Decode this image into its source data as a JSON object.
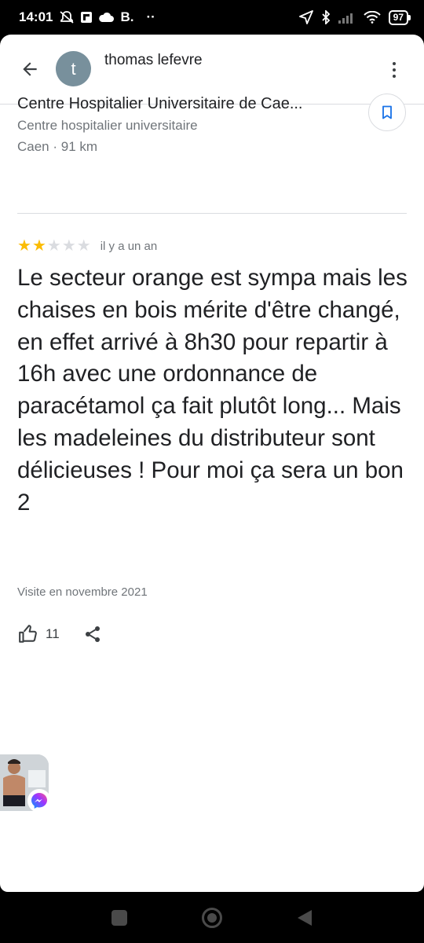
{
  "status_bar": {
    "time": "14:01",
    "notification_letter": "B.",
    "dots": "··",
    "battery": "97",
    "icons": [
      "mute-icon",
      "flipboard-icon",
      "cloud-icon",
      "location-arrow-icon",
      "bluetooth-icon",
      "signal-icon",
      "wifi-icon",
      "battery-icon"
    ]
  },
  "header": {
    "back_icon": "arrow-left-icon",
    "avatar_letter": "t",
    "author_name": "thomas lefevre",
    "more_icon": "more-vert-icon",
    "avatar_color": "#78909c"
  },
  "place": {
    "name": "Centre Hospitalier Universitaire de Cae...",
    "category": "Centre hospitalier universitaire",
    "meta": "Caen · 91 km",
    "save_icon": "bookmark-icon"
  },
  "review": {
    "rating": 2,
    "max_rating": 5,
    "time_ago": "il y a un an",
    "text": "Le secteur orange est sympa mais les chaises en bois mérite d'être changé, en effet arrivé à 8h30 pour repartir à 16h avec une ordonnance de paracétamol ça fait plutôt long... Mais les madeleines du distributeur sont délicieuses ! Pour moi ça sera un bon 2",
    "visit": "Visite en novembre 2021",
    "likes": "11",
    "star_color": "#fbbc04"
  },
  "chat_head": {
    "badge_icon": "messenger-icon"
  },
  "nav_bar": {
    "icons": [
      "recents-square-icon",
      "home-circle-icon",
      "back-triangle-icon"
    ]
  }
}
